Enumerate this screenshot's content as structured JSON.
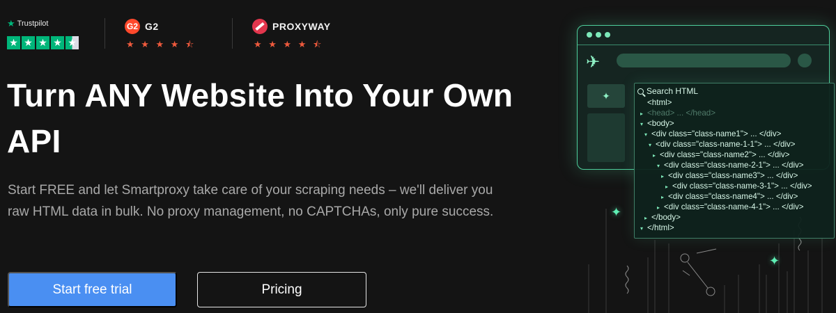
{
  "ratings": {
    "trustpilot": {
      "name": "Trustpilot",
      "stars": 4.5
    },
    "g2": {
      "logo_text": "G2",
      "name": "G2",
      "stars": "★ ★ ★ ★ ⯪"
    },
    "proxyway": {
      "name": "PROXYWAY",
      "stars": "★ ★ ★ ★ ⯪"
    }
  },
  "hero": {
    "headline": "Turn ANY Website Into Your Own API",
    "subtext": "Start FREE and let Smartproxy take care of your scraping needs – we'll deliver you raw HTML data in bulk. No proxy management, no CAPTCHAs, only pure success.",
    "primary_button": "Start free trial",
    "secondary_button": "Pricing"
  },
  "illustration": {
    "search_label": "Search HTML",
    "code_lines": [
      {
        "indent": 0,
        "arrow": "",
        "text": "<html>",
        "dim": false
      },
      {
        "indent": 0,
        "arrow": "▸",
        "text": "<head> ... </head>",
        "dim": true
      },
      {
        "indent": 0,
        "arrow": "▾",
        "text": "<body>",
        "dim": false
      },
      {
        "indent": 1,
        "arrow": "▾",
        "text": "<div class=\"class-name1\"> ... </div>",
        "dim": false
      },
      {
        "indent": 2,
        "arrow": "▾",
        "text": "<div class=\"class-name-1-1\"> ... </div>",
        "dim": false
      },
      {
        "indent": 3,
        "arrow": "▸",
        "text": "<div class=\"class-name2\"> ... </div>",
        "dim": false
      },
      {
        "indent": 4,
        "arrow": "▾",
        "text": "<div class=\"class-name-2-1\"> ... </div>",
        "dim": false
      },
      {
        "indent": 5,
        "arrow": "▸",
        "text": "<div class=\"class-name3\"> ... </div>",
        "dim": false
      },
      {
        "indent": 6,
        "arrow": "▸",
        "text": "<div class=\"class-name-3-1\"> ... </div>",
        "dim": false
      },
      {
        "indent": 5,
        "arrow": "▸",
        "text": "<div class=\"class-name4\"> ... </div>",
        "dim": false
      },
      {
        "indent": 4,
        "arrow": "▸",
        "text": "<div class=\"class-name-4-1\"> ... </div>",
        "dim": false
      },
      {
        "indent": 1,
        "arrow": "▸",
        "text": "</body>",
        "dim": false
      },
      {
        "indent": 0,
        "arrow": "▾",
        "text": "</html>",
        "dim": false
      }
    ]
  },
  "colors": {
    "background": "#141414",
    "primary": "#4a8ff2",
    "accent_green": "#4fcf9c",
    "trustpilot_green": "#00b67a",
    "rating_star": "#ef5a3d"
  }
}
